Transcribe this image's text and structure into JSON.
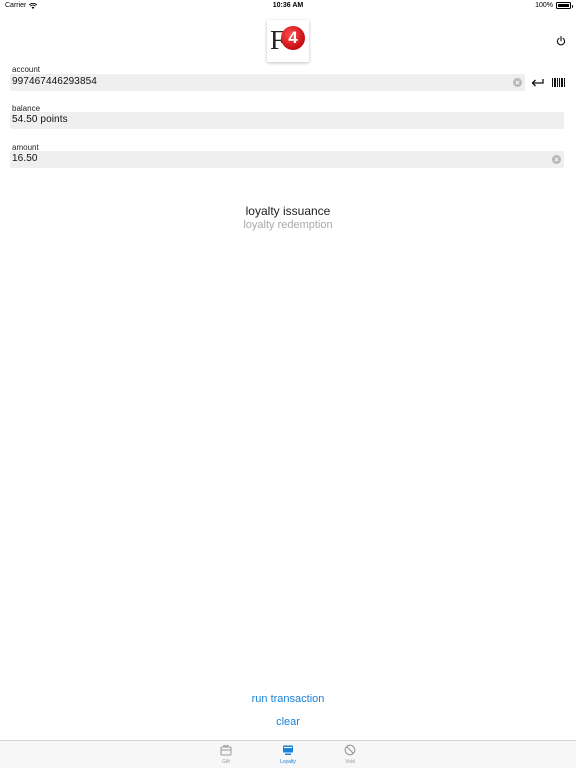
{
  "status_bar": {
    "carrier": "Carrier",
    "time": "10:36 AM",
    "battery": "100%"
  },
  "header": {
    "logo_letter": "F",
    "logo_number": "4",
    "logo_color": "#d3141a",
    "power_icon": "power-icon"
  },
  "fields": {
    "account": {
      "label": "account",
      "value": "997467446293854"
    },
    "balance": {
      "label": "balance",
      "value": "54.50 points"
    },
    "amount": {
      "label": "amount",
      "value": "16.50"
    }
  },
  "mode_picker": {
    "selected": "loyalty issuance",
    "options": [
      "loyalty redemption"
    ]
  },
  "actions": {
    "run": "run transaction",
    "clear": "clear",
    "link_color": "#1a82d8"
  },
  "tabs": [
    {
      "label": "Gift",
      "icon": "gift-card-icon",
      "active": false
    },
    {
      "label": "Loyalty",
      "icon": "loyalty-card-icon",
      "active": true
    },
    {
      "label": "Void",
      "icon": "void-icon",
      "active": false
    }
  ],
  "colors": {
    "tab_active": "#1a82d8",
    "tab_inactive": "#9a9a9a"
  }
}
